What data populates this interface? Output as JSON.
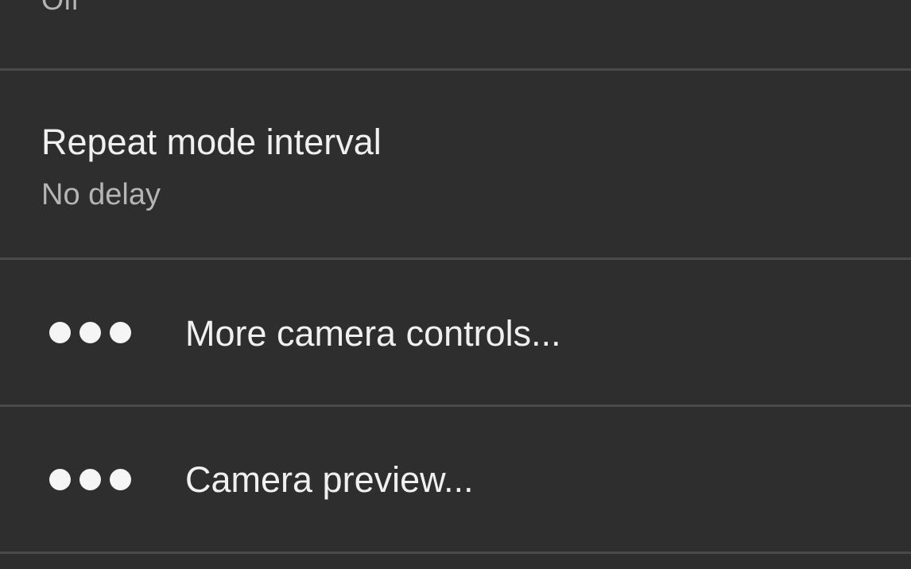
{
  "settings": {
    "previous_item": {
      "summary": "Off"
    },
    "repeat_mode_interval": {
      "title": "Repeat mode interval",
      "summary": "No delay"
    },
    "more_camera_controls": {
      "icon": "more-horizontal-icon",
      "label": "More camera controls..."
    },
    "camera_preview": {
      "icon": "more-horizontal-icon",
      "label": "Camera preview..."
    }
  }
}
